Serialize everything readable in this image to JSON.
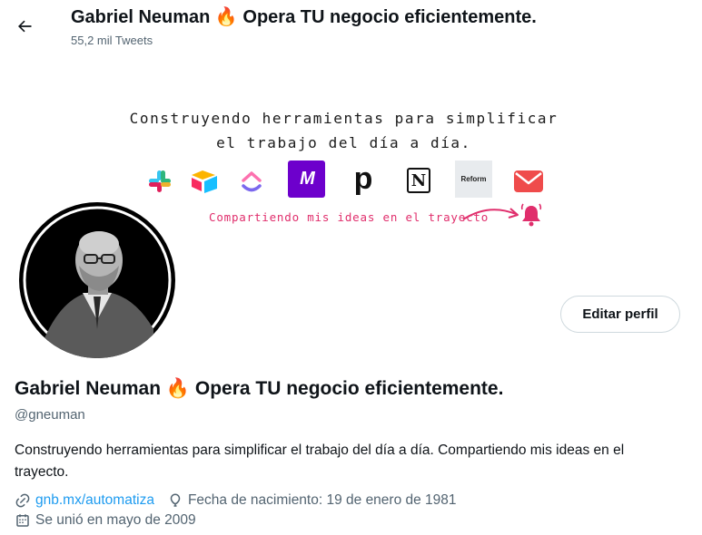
{
  "header": {
    "title": "Gabriel Neuman 🔥 Opera TU negocio eficientemente.",
    "tweet_count": "55,2 mil Tweets",
    "back_icon": "arrow-left-icon"
  },
  "banner": {
    "line1": "Construyendo herramientas para simplificar",
    "line2": "el trabajo del día a día.",
    "tagline": "Compartiendo mis ideas en el trayecto",
    "logos": [
      "slack",
      "airtable",
      "clickup",
      "make",
      "pipedream",
      "notion",
      "reform",
      "gmail"
    ],
    "logo_text_make": "M",
    "logo_text_pipedream": "p",
    "logo_text_notion": "N",
    "logo_text_reform": "Reform",
    "accent": "#e02e6c"
  },
  "actions": {
    "edit_profile": "Editar perfil"
  },
  "profile": {
    "name": "Gabriel Neuman 🔥 Opera TU negocio eficientemente.",
    "handle": "@gneuman",
    "bio": "Construyendo herramientas para simplificar el trabajo del día a día. Compartiendo mis ideas en el trayecto.",
    "website": "gnb.mx/automatiza",
    "birthday": "Fecha de nacimiento: 19 de enero de 1981",
    "joined": "Se unió en mayo de 2009"
  },
  "colors": {
    "link": "#1d9bf0",
    "secondary_text": "#536471",
    "primary_text": "#0f1419"
  }
}
